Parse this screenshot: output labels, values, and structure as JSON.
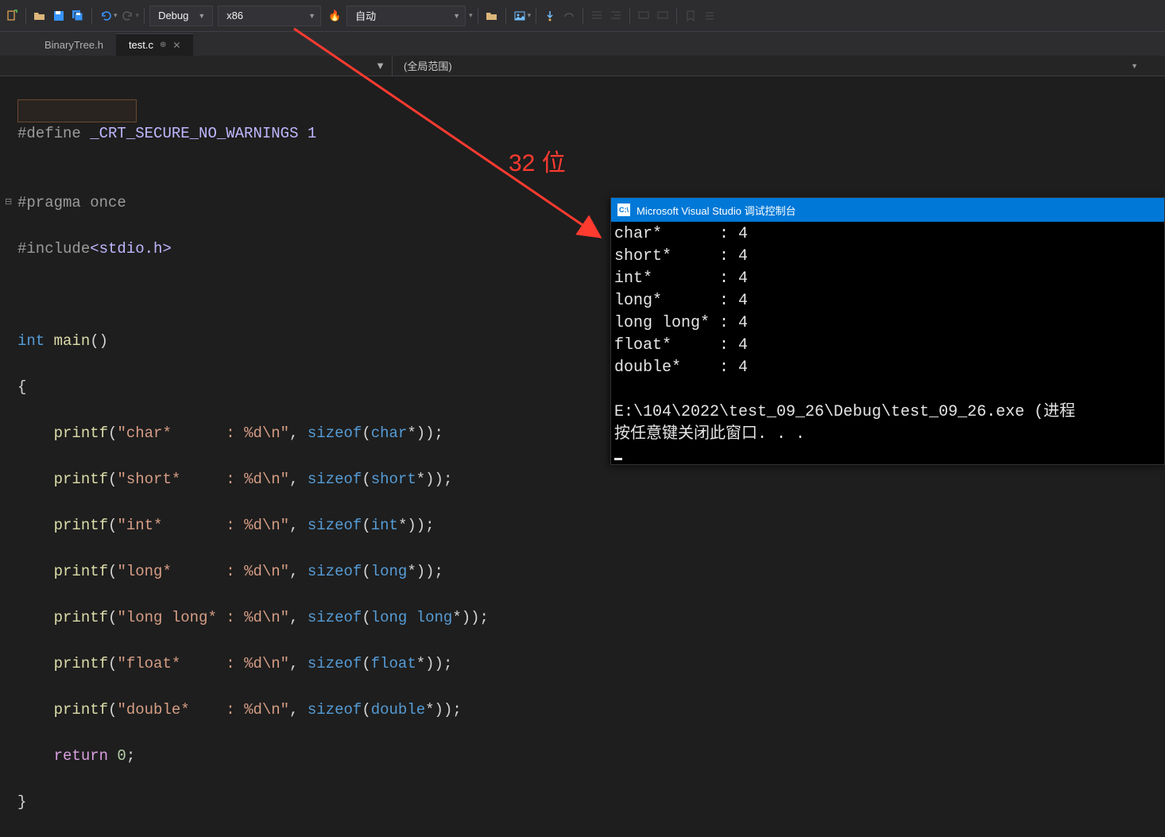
{
  "toolbar": {
    "config": "Debug",
    "platform": "x86",
    "auto_label": "自动"
  },
  "tabs": {
    "inactive": "BinaryTree.h",
    "active": "test.c"
  },
  "scope": {
    "label": "(全局范围)"
  },
  "code": {
    "l1_pre": "#define",
    "l1_macro": " _CRT_SECURE_NO_WARNINGS 1",
    "l2": "#pragma once",
    "l3_pre": "#include",
    "l3_inc": "<stdio.h>",
    "l5_type": "int",
    "l5_main": " main",
    "l5_paren": "()",
    "l6": "{",
    "p_name": "printf",
    "s_name": "sizeof",
    "str1": "\"char*      : %d\\n\"",
    "str2": "\"short*     : %d\\n\"",
    "str3": "\"int*       : %d\\n\"",
    "str4": "\"long*      : %d\\n\"",
    "str5": "\"long long* : %d\\n\"",
    "str6": "\"float*     : %d\\n\"",
    "str7": "\"double*    : %d\\n\"",
    "t1": "char",
    "t2": "short",
    "t3": "int",
    "t4": "long",
    "t5a": "long",
    "t5b": " long",
    "t6": "float",
    "t7": "double",
    "ret": "return",
    "ret_val": " 0",
    "semi": ";",
    "close": "}"
  },
  "annotation": "32 位",
  "console": {
    "title": "Microsoft Visual Studio 调试控制台",
    "lines": [
      "char*      : 4",
      "short*     : 4",
      "int*       : 4",
      "long*      : 4",
      "long long* : 4",
      "float*     : 4",
      "double*    : 4"
    ],
    "path": "E:\\104\\2022\\test_09_26\\Debug\\test_09_26.exe (进程",
    "prompt": "按任意键关闭此窗口. . ."
  }
}
